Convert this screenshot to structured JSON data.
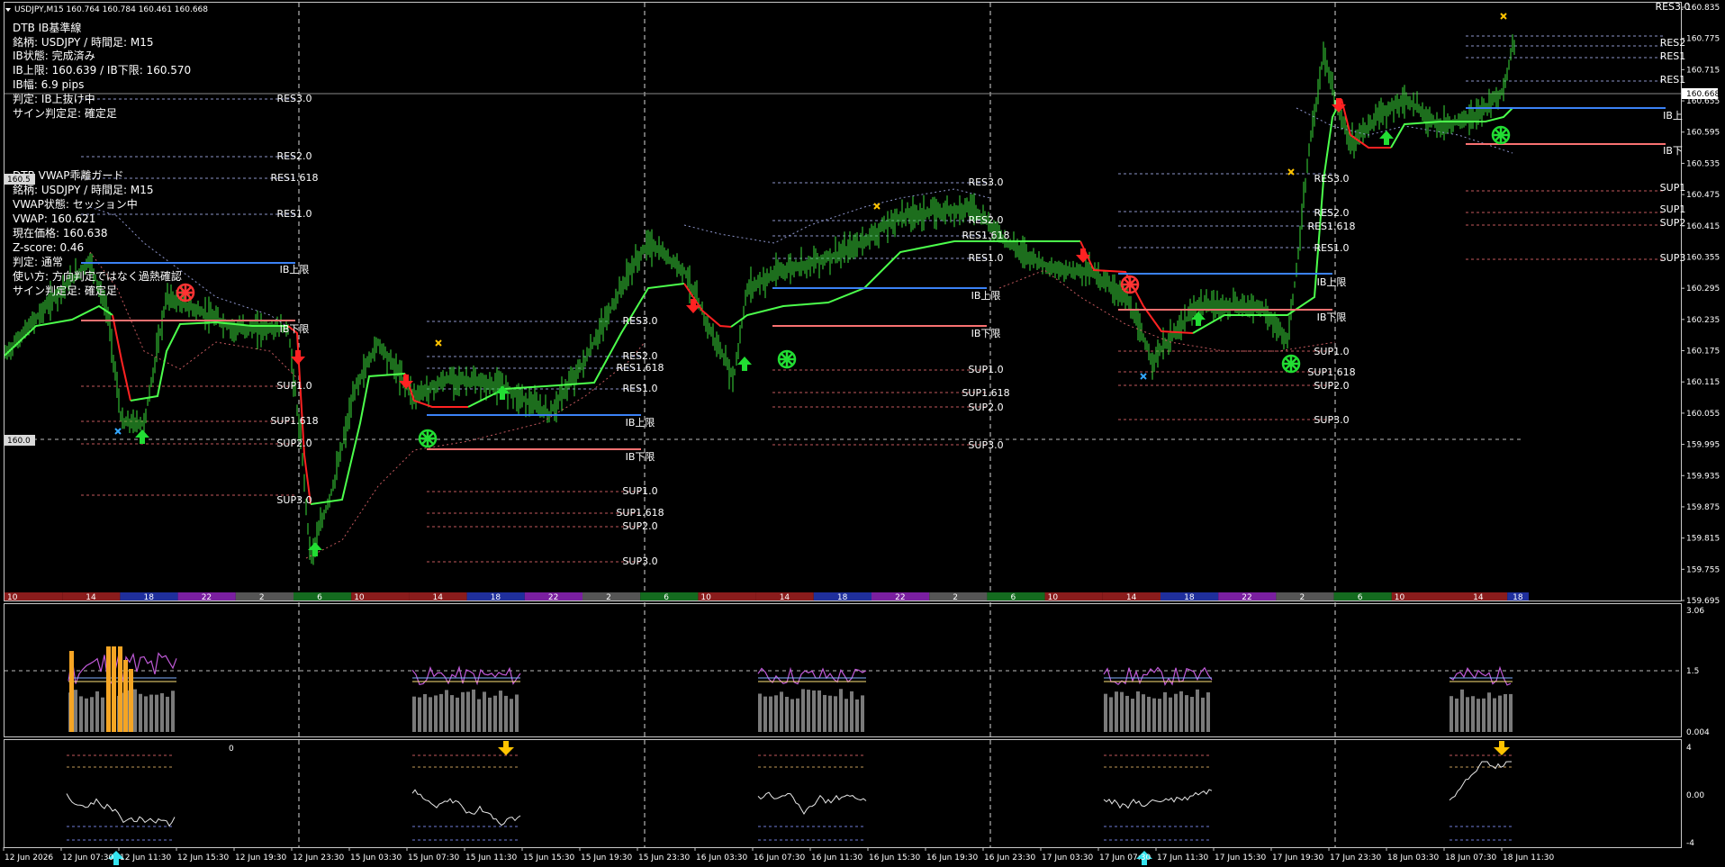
{
  "header": {
    "symbol_line": "USDJPY,M15  160.764 160.784 160.461 160.668"
  },
  "info_panel_ib": {
    "lines": [
      "DTB IB基準線",
      "銘柄: USDJPY / 時間足: M15",
      "IB状態: 完成済み",
      "IB上限: 160.639 / IB下限: 160.570",
      "IB幅: 6.9 pips",
      "判定: IB上抜け中",
      "サイン判定足: 確定足"
    ]
  },
  "info_panel_vwap": {
    "lines": [
      "DTB VWAP乖離ガード",
      "銘柄: USDJPY / 時間足: M15",
      "VWAP状態: セッション中",
      "VWAP: 160.621",
      "現在価格: 160.638",
      "Z-score: 0.46",
      "判定: 通常",
      "使い方: 方向判定ではなく過熱確認",
      "サイン判定足: 確定足"
    ]
  },
  "price_axis": {
    "labels": [
      "160.835",
      "160.775",
      "160.715",
      "160.655",
      "160.595",
      "160.535",
      "160.475",
      "160.415",
      "160.355",
      "160.295",
      "160.235",
      "160.175",
      "160.115",
      "160.055",
      "159.995",
      "159.935",
      "159.875",
      "159.815",
      "159.755",
      "159.695"
    ],
    "current_price": "160.668",
    "left_marker_top": "160.5",
    "left_marker_bottom": "160.0"
  },
  "sub1_axis": {
    "labels": [
      "3.06",
      "1.5",
      "0.004"
    ]
  },
  "sub2_axis": {
    "labels": [
      "4",
      "0.00",
      "-4"
    ]
  },
  "sub2_corner_label": "0",
  "time_axis": {
    "labels": [
      "12 Jun 2026",
      "12 Jun 07:30",
      "12 Jun 11:30",
      "12 Jun 15:30",
      "12 Jun 19:30",
      "12 Jun 23:30",
      "15 Jun 03:30",
      "15 Jun 07:30",
      "15 Jun 11:30",
      "15 Jun 15:30",
      "15 Jun 19:30",
      "15 Jun 23:30",
      "16 Jun 03:30",
      "16 Jun 07:30",
      "16 Jun 11:30",
      "16 Jun 15:30",
      "16 Jun 19:30",
      "16 Jun 23:30",
      "17 Jun 03:30",
      "17 Jun 07:30",
      "17 Jun 11:30",
      "17 Jun 15:30",
      "17 Jun 19:30",
      "17 Jun 23:30",
      "18 Jun 03:30",
      "18 Jun 07:30",
      "18 Jun 11:30"
    ]
  },
  "session_bar": {
    "hours": [
      "10",
      "14",
      "18",
      "22",
      "2",
      "6",
      "10",
      "14",
      "18",
      "22",
      "2",
      "6",
      "10",
      "14",
      "18",
      "22",
      "2",
      "6",
      "10",
      "14",
      "18",
      "22",
      "2",
      "6",
      "10",
      "14",
      "18"
    ]
  },
  "levels": {
    "day1": {
      "res3": "RES3.0",
      "res2": "RES2.0",
      "res1618": "RES1.618",
      "res1": "RES1.0",
      "ib_hi": "IB上限",
      "ib_lo": "IB下限",
      "sup1": "SUP1.0",
      "sup1618": "SUP1.618",
      "sup2": "SUP2.0",
      "sup3": "SUP3.0"
    },
    "day2": {
      "res3": "RES3.0",
      "res2": "RES2.0",
      "res1618": "RES1.618",
      "res1": "RES1.0",
      "ib_hi": "IB上限",
      "ib_lo": "IB下限",
      "sup1": "SUP1.0",
      "sup1618": "SUP1.618",
      "sup2": "SUP2.0",
      "sup3": "SUP3.0"
    },
    "day3": {
      "res3": "RES3.0",
      "res2": "RES2.0",
      "res1618": "RES1.618",
      "res1": "RES1.0",
      "ib_hi": "IB上限",
      "ib_lo": "IB下限",
      "sup1": "SUP1.0",
      "sup1618": "SUP1.618",
      "sup2": "SUP2.0",
      "sup3": "SUP3.0"
    },
    "day4": {
      "res3": "RES3.0",
      "res2": "RES2.0",
      "res1618": "RES1.618",
      "res1": "RES1.0",
      "ib_hi": "IB上限",
      "ib_lo": "IB下限",
      "sup1": "SUP1.0",
      "sup1618": "SUP1.618",
      "sup2": "SUP2.0",
      "sup3": "SUP3.0"
    },
    "day5": {
      "res3": "RES3.0",
      "res2": "RES2",
      "res1618": "RES1",
      "res1": "RES1",
      "ib_hi": "IB上",
      "ib_lo": "IB下",
      "sup1": "SUP1",
      "sup1618": "SUP1",
      "sup2": "SUP2",
      "sup3": "SUP3"
    }
  },
  "colors": {
    "background": "#000000",
    "candle": "#3adb3a",
    "vwap_up": "#4cff4c",
    "vwap_down": "#ff2222",
    "ib_high": "#3b82f6",
    "ib_low": "#f87171",
    "level_res": "#8b93c9",
    "level_sup": "#c2585d",
    "grid": "#c8c8c8",
    "text": "#ffffff",
    "histogram_orange": "#f5a524",
    "histogram_gray": "#7a7a7a",
    "oscillator_purple": "#c05ad8",
    "arrow_up_cyan": "#34e3ef",
    "arrow_down_yellow": "#ffc400",
    "marker_red": "#ff2222",
    "marker_green": "#22dd33"
  }
}
